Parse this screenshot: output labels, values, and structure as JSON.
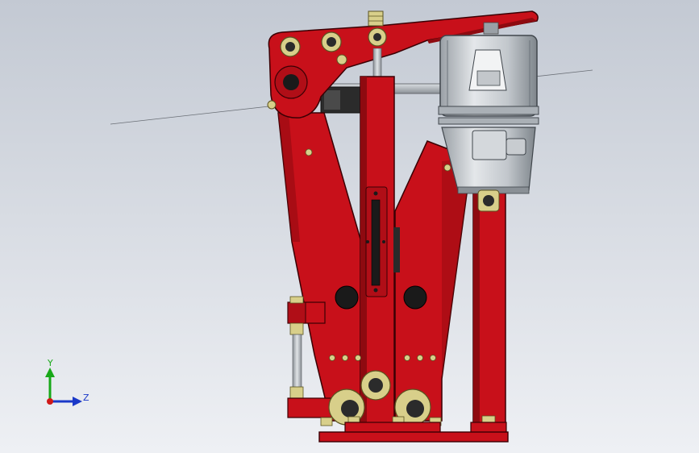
{
  "viewport": {
    "background_top": "#c3c9d3",
    "background_bottom": "#eef0f4"
  },
  "colors": {
    "frame_red": "#c8101a",
    "frame_red_dark": "#8e0a10",
    "frame_edge": "#3a0004",
    "thruster_body": "#c8cdd2",
    "thruster_dark": "#6d747b",
    "bolt_fill": "#d8cf8a",
    "bolt_edge": "#5a5321",
    "rod_grey": "#a9aeb4",
    "pad_black": "#2a2a2a"
  },
  "triad": {
    "y_label": "Y",
    "z_label": "Z",
    "y_color": "#18a818",
    "z_color": "#1a38c8",
    "x_color": "#d01818"
  },
  "model": {
    "name": "brake-assembly",
    "components": [
      "lever-arm",
      "left-brake-arm",
      "right-brake-arm",
      "center-column",
      "thruster",
      "base-plate",
      "spring-rod"
    ]
  }
}
